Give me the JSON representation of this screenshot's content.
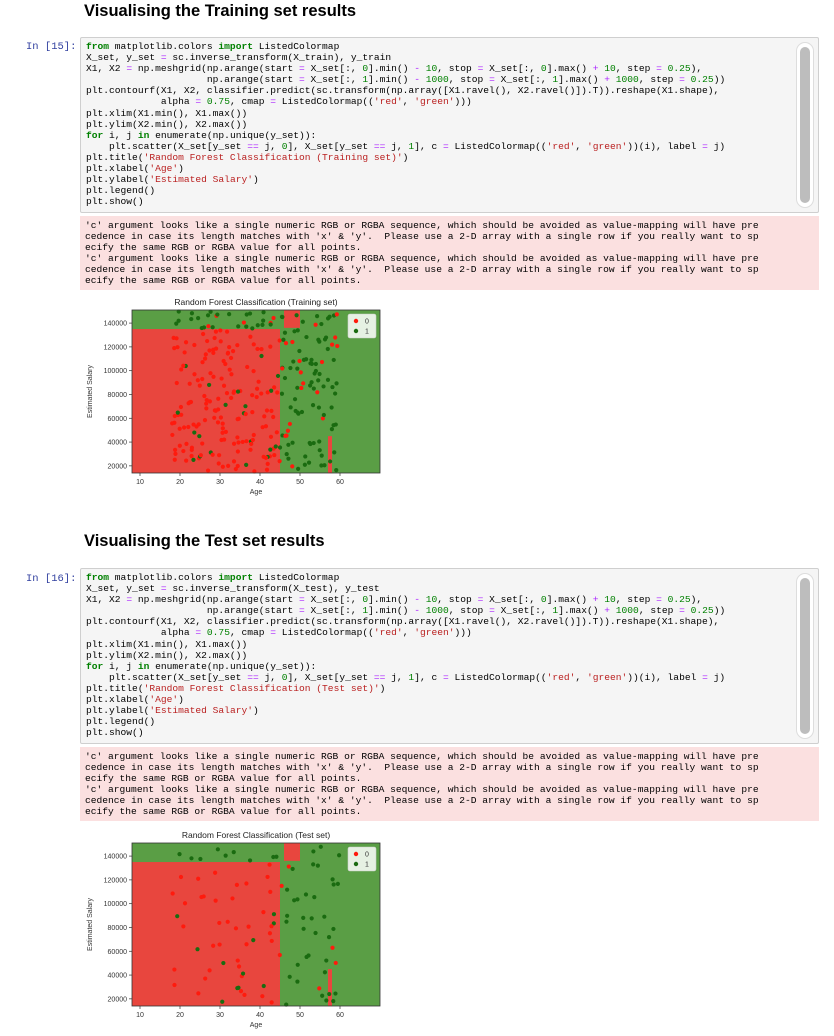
{
  "sections": [
    {
      "heading": "Visualising the Training set results",
      "prompt": "In [15]:",
      "code_lines": [
        [
          [
            "kw",
            "from"
          ],
          [
            "t",
            " matplotlib.colors "
          ],
          [
            "kw",
            "import"
          ],
          [
            "t",
            " ListedColormap"
          ]
        ],
        [
          [
            "t",
            "X_set, y_set "
          ],
          [
            "op",
            "="
          ],
          [
            "t",
            " sc.inverse_transform(X_train), y_train"
          ]
        ],
        [
          [
            "t",
            "X1, X2 "
          ],
          [
            "op",
            "="
          ],
          [
            "t",
            " np.meshgrid(np.arange(start "
          ],
          [
            "op",
            "="
          ],
          [
            "t",
            " X_set[:, "
          ],
          [
            "num",
            "0"
          ],
          [
            "t",
            "].min() "
          ],
          [
            "op",
            "-"
          ],
          [
            "t",
            " "
          ],
          [
            "num",
            "10"
          ],
          [
            "t",
            ", stop "
          ],
          [
            "op",
            "="
          ],
          [
            "t",
            " X_set[:, "
          ],
          [
            "num",
            "0"
          ],
          [
            "t",
            "].max() "
          ],
          [
            "op",
            "+"
          ],
          [
            "t",
            " "
          ],
          [
            "num",
            "10"
          ],
          [
            "t",
            ", step "
          ],
          [
            "op",
            "="
          ],
          [
            "t",
            " "
          ],
          [
            "num",
            "0.25"
          ],
          [
            "t",
            "),"
          ]
        ],
        [
          [
            "t",
            "                     np.arange(start "
          ],
          [
            "op",
            "="
          ],
          [
            "t",
            " X_set[:, "
          ],
          [
            "num",
            "1"
          ],
          [
            "t",
            "].min() "
          ],
          [
            "op",
            "-"
          ],
          [
            "t",
            " "
          ],
          [
            "num",
            "1000"
          ],
          [
            "t",
            ", stop "
          ],
          [
            "op",
            "="
          ],
          [
            "t",
            " X_set[:, "
          ],
          [
            "num",
            "1"
          ],
          [
            "t",
            "].max() "
          ],
          [
            "op",
            "+"
          ],
          [
            "t",
            " "
          ],
          [
            "num",
            "1000"
          ],
          [
            "t",
            ", step "
          ],
          [
            "op",
            "="
          ],
          [
            "t",
            " "
          ],
          [
            "num",
            "0.25"
          ],
          [
            "t",
            "))"
          ]
        ],
        [
          [
            "t",
            "plt.contourf(X1, X2, classifier.predict(sc.transform(np.array([X1.ravel(), X2.ravel()]).T)).reshape(X1.shape),"
          ]
        ],
        [
          [
            "t",
            "             alpha "
          ],
          [
            "op",
            "="
          ],
          [
            "t",
            " "
          ],
          [
            "num",
            "0.75"
          ],
          [
            "t",
            ", cmap "
          ],
          [
            "op",
            "="
          ],
          [
            "t",
            " ListedColormap(("
          ],
          [
            "str",
            "'red'"
          ],
          [
            "t",
            ", "
          ],
          [
            "str",
            "'green'"
          ],
          [
            "t",
            ")))"
          ]
        ],
        [
          [
            "t",
            "plt.xlim(X1.min(), X1.max())"
          ]
        ],
        [
          [
            "t",
            "plt.ylim(X2.min(), X2.max())"
          ]
        ],
        [
          [
            "kw",
            "for"
          ],
          [
            "t",
            " i, j "
          ],
          [
            "kw",
            "in"
          ],
          [
            "t",
            " enumerate(np.unique(y_set)):"
          ]
        ],
        [
          [
            "t",
            "    plt.scatter(X_set[y_set "
          ],
          [
            "op",
            "=="
          ],
          [
            "t",
            " j, "
          ],
          [
            "num",
            "0"
          ],
          [
            "t",
            "], X_set[y_set "
          ],
          [
            "op",
            "=="
          ],
          [
            "t",
            " j, "
          ],
          [
            "num",
            "1"
          ],
          [
            "t",
            "], c "
          ],
          [
            "op",
            "="
          ],
          [
            "t",
            " ListedColormap(("
          ],
          [
            "str",
            "'red'"
          ],
          [
            "t",
            ", "
          ],
          [
            "str",
            "'green'"
          ],
          [
            "t",
            "))(i), label "
          ],
          [
            "op",
            "="
          ],
          [
            "t",
            " j)"
          ]
        ],
        [
          [
            "t",
            "plt.title("
          ],
          [
            "str",
            "'Random Forest Classification (Training set)'"
          ],
          [
            "t",
            ")"
          ]
        ],
        [
          [
            "t",
            "plt.xlabel("
          ],
          [
            "str",
            "'Age'"
          ],
          [
            "t",
            ")"
          ]
        ],
        [
          [
            "t",
            "plt.ylabel("
          ],
          [
            "str",
            "'Estimated Salary'"
          ],
          [
            "t",
            ")"
          ]
        ],
        [
          [
            "t",
            "plt.legend()"
          ]
        ],
        [
          [
            "t",
            "plt.show()"
          ]
        ]
      ],
      "stderr": "'c' argument looks like a single numeric RGB or RGBA sequence, which should be avoided as value-mapping will have pre\ncedence in case its length matches with 'x' & 'y'.  Please use a 2-D array with a single row if you really want to sp\necify the same RGB or RGBA value for all points.\n'c' argument looks like a single numeric RGB or RGBA sequence, which should be avoided as value-mapping will have pre\ncedence in case its length matches with 'x' & 'y'.  Please use a 2-D array with a single row if you really want to sp\necify the same RGB or RGBA value for all points.",
      "seed": 17
    },
    {
      "heading": "Visualising the Test set results",
      "prompt": "In [16]:",
      "code_lines": [
        [
          [
            "kw",
            "from"
          ],
          [
            "t",
            " matplotlib.colors "
          ],
          [
            "kw",
            "import"
          ],
          [
            "t",
            " ListedColormap"
          ]
        ],
        [
          [
            "t",
            "X_set, y_set "
          ],
          [
            "op",
            "="
          ],
          [
            "t",
            " sc.inverse_transform(X_test), y_test"
          ]
        ],
        [
          [
            "t",
            "X1, X2 "
          ],
          [
            "op",
            "="
          ],
          [
            "t",
            " np.meshgrid(np.arange(start "
          ],
          [
            "op",
            "="
          ],
          [
            "t",
            " X_set[:, "
          ],
          [
            "num",
            "0"
          ],
          [
            "t",
            "].min() "
          ],
          [
            "op",
            "-"
          ],
          [
            "t",
            " "
          ],
          [
            "num",
            "10"
          ],
          [
            "t",
            ", stop "
          ],
          [
            "op",
            "="
          ],
          [
            "t",
            " X_set[:, "
          ],
          [
            "num",
            "0"
          ],
          [
            "t",
            "].max() "
          ],
          [
            "op",
            "+"
          ],
          [
            "t",
            " "
          ],
          [
            "num",
            "10"
          ],
          [
            "t",
            ", step "
          ],
          [
            "op",
            "="
          ],
          [
            "t",
            " "
          ],
          [
            "num",
            "0.25"
          ],
          [
            "t",
            "),"
          ]
        ],
        [
          [
            "t",
            "                     np.arange(start "
          ],
          [
            "op",
            "="
          ],
          [
            "t",
            " X_set[:, "
          ],
          [
            "num",
            "1"
          ],
          [
            "t",
            "].min() "
          ],
          [
            "op",
            "-"
          ],
          [
            "t",
            " "
          ],
          [
            "num",
            "1000"
          ],
          [
            "t",
            ", stop "
          ],
          [
            "op",
            "="
          ],
          [
            "t",
            " X_set[:, "
          ],
          [
            "num",
            "1"
          ],
          [
            "t",
            "].max() "
          ],
          [
            "op",
            "+"
          ],
          [
            "t",
            " "
          ],
          [
            "num",
            "1000"
          ],
          [
            "t",
            ", step "
          ],
          [
            "op",
            "="
          ],
          [
            "t",
            " "
          ],
          [
            "num",
            "0.25"
          ],
          [
            "t",
            "))"
          ]
        ],
        [
          [
            "t",
            "plt.contourf(X1, X2, classifier.predict(sc.transform(np.array([X1.ravel(), X2.ravel()]).T)).reshape(X1.shape),"
          ]
        ],
        [
          [
            "t",
            "             alpha "
          ],
          [
            "op",
            "="
          ],
          [
            "t",
            " "
          ],
          [
            "num",
            "0.75"
          ],
          [
            "t",
            ", cmap "
          ],
          [
            "op",
            "="
          ],
          [
            "t",
            " ListedColormap(("
          ],
          [
            "str",
            "'red'"
          ],
          [
            "t",
            ", "
          ],
          [
            "str",
            "'green'"
          ],
          [
            "t",
            ")))"
          ]
        ],
        [
          [
            "t",
            "plt.xlim(X1.min(), X1.max())"
          ]
        ],
        [
          [
            "t",
            "plt.ylim(X2.min(), X2.max())"
          ]
        ],
        [
          [
            "kw",
            "for"
          ],
          [
            "t",
            " i, j "
          ],
          [
            "kw",
            "in"
          ],
          [
            "t",
            " enumerate(np.unique(y_set)):"
          ]
        ],
        [
          [
            "t",
            "    plt.scatter(X_set[y_set "
          ],
          [
            "op",
            "=="
          ],
          [
            "t",
            " j, "
          ],
          [
            "num",
            "0"
          ],
          [
            "t",
            "], X_set[y_set "
          ],
          [
            "op",
            "=="
          ],
          [
            "t",
            " j, "
          ],
          [
            "num",
            "1"
          ],
          [
            "t",
            "], c "
          ],
          [
            "op",
            "="
          ],
          [
            "t",
            " ListedColormap(("
          ],
          [
            "str",
            "'red'"
          ],
          [
            "t",
            ", "
          ],
          [
            "str",
            "'green'"
          ],
          [
            "t",
            "))(i), label "
          ],
          [
            "op",
            "="
          ],
          [
            "t",
            " j)"
          ]
        ],
        [
          [
            "t",
            "plt.title("
          ],
          [
            "str",
            "'Random Forest Classification (Test set)'"
          ],
          [
            "t",
            ")"
          ]
        ],
        [
          [
            "t",
            "plt.xlabel("
          ],
          [
            "str",
            "'Age'"
          ],
          [
            "t",
            ")"
          ]
        ],
        [
          [
            "t",
            "plt.ylabel("
          ],
          [
            "str",
            "'Estimated Salary'"
          ],
          [
            "t",
            ")"
          ]
        ],
        [
          [
            "t",
            "plt.legend()"
          ]
        ],
        [
          [
            "t",
            "plt.show()"
          ]
        ]
      ],
      "stderr": "'c' argument looks like a single numeric RGB or RGBA sequence, which should be avoided as value-mapping will have pre\ncedence in case its length matches with 'x' & 'y'.  Please use a 2-D array with a single row if you really want to sp\necify the same RGB or RGBA value for all points.\n'c' argument looks like a single numeric RGB or RGBA sequence, which should be avoided as value-mapping will have pre\ncedence in case its length matches with 'x' & 'y'.  Please use a 2-D array with a single row if you really want to sp\necify the same RGB or RGBA value for all points.",
      "seed": 29
    }
  ],
  "colors": {
    "region_red": "#e8463e",
    "region_green": "#5a9e45",
    "point_red": "#ff1a0d",
    "point_green": "#1a6b10"
  },
  "chart_data": [
    {
      "type": "scatter",
      "title": "Random Forest Classification (Training set)",
      "xlabel": "Age",
      "ylabel": "Estimated Salary",
      "xlim": [
        8,
        70
      ],
      "ylim": [
        14000,
        151000
      ],
      "xticks": [
        10,
        20,
        30,
        40,
        50,
        60
      ],
      "yticks": [
        20000,
        40000,
        60000,
        80000,
        100000,
        120000,
        140000
      ],
      "legend": {
        "placement": "top-right",
        "entries": [
          "0",
          "1"
        ]
      },
      "series": [
        {
          "name": "0",
          "color": "red"
        },
        {
          "name": "1",
          "color": "green"
        }
      ],
      "regions": [
        {
          "class": "1",
          "x": [
            8,
            70
          ],
          "y": [
            14000,
            151000
          ]
        },
        {
          "class": "0",
          "x": [
            8,
            45
          ],
          "y": [
            14000,
            135000
          ]
        },
        {
          "class": "0",
          "x": [
            25,
            41
          ],
          "y": [
            85000,
            100000
          ]
        },
        {
          "class": "0",
          "x": [
            46,
            50
          ],
          "y": [
            136000,
            151000
          ]
        },
        {
          "class": "0",
          "x": [
            57,
            58
          ],
          "y": [
            14000,
            45000
          ]
        }
      ]
    },
    {
      "type": "scatter",
      "title": "Random Forest Classification (Test set)",
      "xlabel": "Age",
      "ylabel": "Estimated Salary",
      "xlim": [
        8,
        70
      ],
      "ylim": [
        14000,
        151000
      ],
      "xticks": [
        10,
        20,
        30,
        40,
        50,
        60
      ],
      "yticks": [
        20000,
        40000,
        60000,
        80000,
        100000,
        120000,
        140000
      ],
      "legend": {
        "placement": "top-right",
        "entries": [
          "0",
          "1"
        ]
      },
      "series": [
        {
          "name": "0",
          "color": "red"
        },
        {
          "name": "1",
          "color": "green"
        }
      ],
      "regions": [
        {
          "class": "1",
          "x": [
            8,
            70
          ],
          "y": [
            14000,
            151000
          ]
        },
        {
          "class": "0",
          "x": [
            8,
            45
          ],
          "y": [
            14000,
            135000
          ]
        },
        {
          "class": "0",
          "x": [
            25,
            41
          ],
          "y": [
            85000,
            100000
          ]
        },
        {
          "class": "0",
          "x": [
            46,
            50
          ],
          "y": [
            136000,
            151000
          ]
        },
        {
          "class": "0",
          "x": [
            57,
            58
          ],
          "y": [
            14000,
            45000
          ]
        }
      ]
    }
  ]
}
